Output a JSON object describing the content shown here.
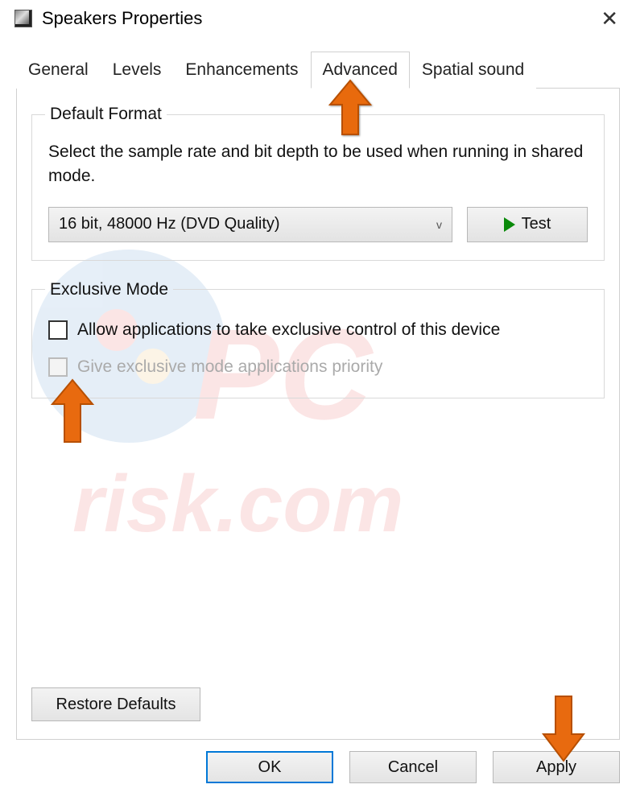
{
  "window": {
    "title": "Speakers Properties"
  },
  "tabs": {
    "general": "General",
    "levels": "Levels",
    "enhancements": "Enhancements",
    "advanced": "Advanced",
    "spatial": "Spatial sound"
  },
  "default_format": {
    "legend": "Default Format",
    "description": "Select the sample rate and bit depth to be used when running in shared mode.",
    "selected": "16 bit, 48000 Hz (DVD Quality)",
    "test_label": "Test"
  },
  "exclusive_mode": {
    "legend": "Exclusive Mode",
    "allow_label": "Allow applications to take exclusive control of this device",
    "priority_label": "Give exclusive mode applications priority"
  },
  "buttons": {
    "restore": "Restore Defaults",
    "ok": "OK",
    "cancel": "Cancel",
    "apply": "Apply"
  }
}
